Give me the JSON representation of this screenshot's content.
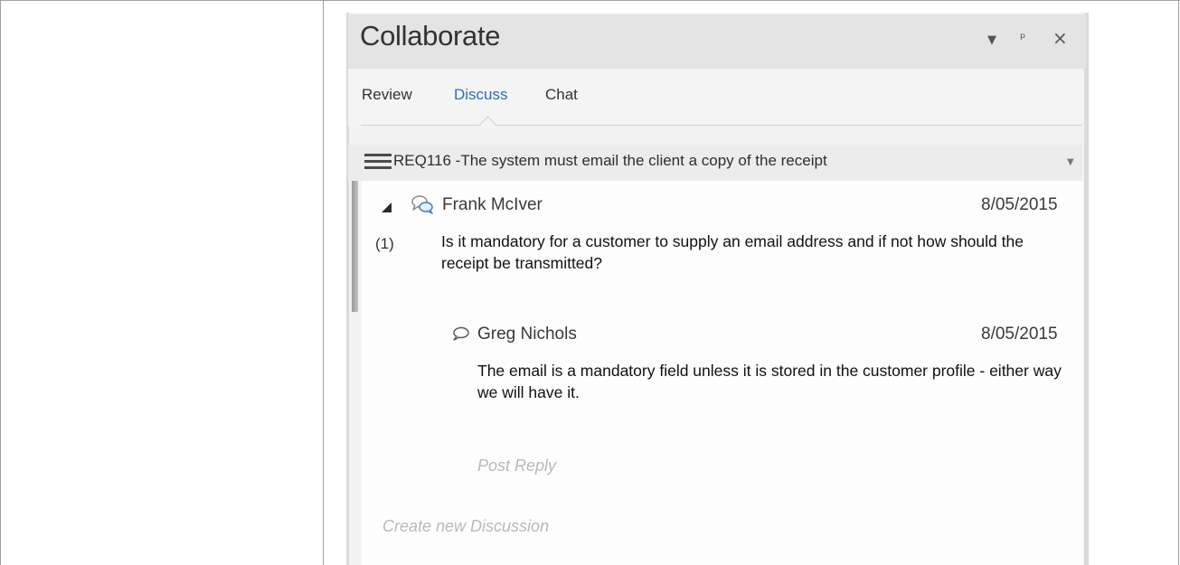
{
  "panel": {
    "title": "Collaborate",
    "icons": [
      "dropdown-icon",
      "pin-icon",
      "close-icon"
    ]
  },
  "tabs": [
    {
      "label": "Review",
      "active": false
    },
    {
      "label": "Discuss",
      "active": true
    },
    {
      "label": "Chat",
      "active": false
    }
  ],
  "element": {
    "label": "REQ116 -The system must email the client a copy of the receipt",
    "icon": "hamburger-menu-icon"
  },
  "discussion": {
    "author": "Frank McIver",
    "date": "8/05/2015",
    "reply_count": "(1)",
    "message": "Is it mandatory for a customer to supply an email address and if not how should the receipt be transmitted?",
    "icon": "discussion-icon"
  },
  "reply": {
    "author": "Greg Nichols",
    "date": "8/05/2015",
    "message": "The email is a  mandatory field unless it is stored in the customer  profile - either way we will have it.",
    "icon": "reply-speech-icon"
  },
  "actions": {
    "post_reply_placeholder": "Post Reply",
    "create_discussion_placeholder": "Create new Discussion"
  },
  "colors": {
    "active_tab": "#2a6fc4",
    "placeholder": "#b9b9b9"
  }
}
